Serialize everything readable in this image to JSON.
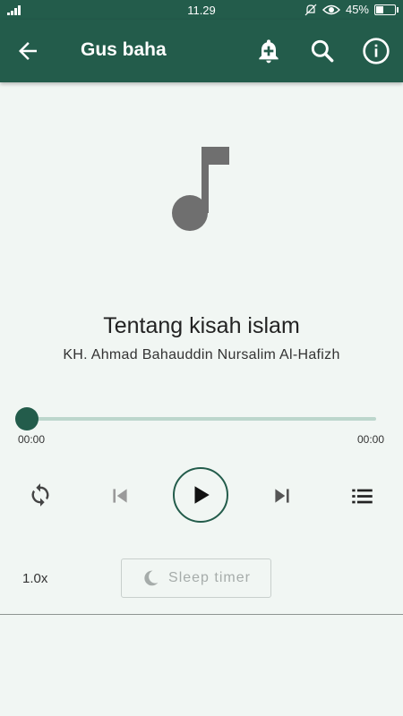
{
  "status_bar": {
    "time": "11.29",
    "battery": "45%",
    "battery_level": 0.45
  },
  "app_bar": {
    "title": "Gus baha"
  },
  "track": {
    "title": "Tentang kisah islam",
    "artist": "KH. Ahmad Bahauddin Nursalim Al-Hafizh"
  },
  "player": {
    "current_time": "00:00",
    "duration": "00:00",
    "progress": 0,
    "speed": "1.0x",
    "sleep_timer_label": "Sleep timer"
  },
  "colors": {
    "primary": "#235c4b",
    "background": "#f1f6f3",
    "track_inactive": "#bcd6cc"
  },
  "icons": [
    "signal-icon",
    "mute-icon",
    "eye-icon",
    "battery-icon",
    "back-icon",
    "add-alarm-icon",
    "search-icon",
    "info-icon",
    "music-note-icon",
    "repeat-icon",
    "skip-previous-icon",
    "play-icon",
    "skip-next-icon",
    "playlist-icon",
    "moon-icon"
  ]
}
